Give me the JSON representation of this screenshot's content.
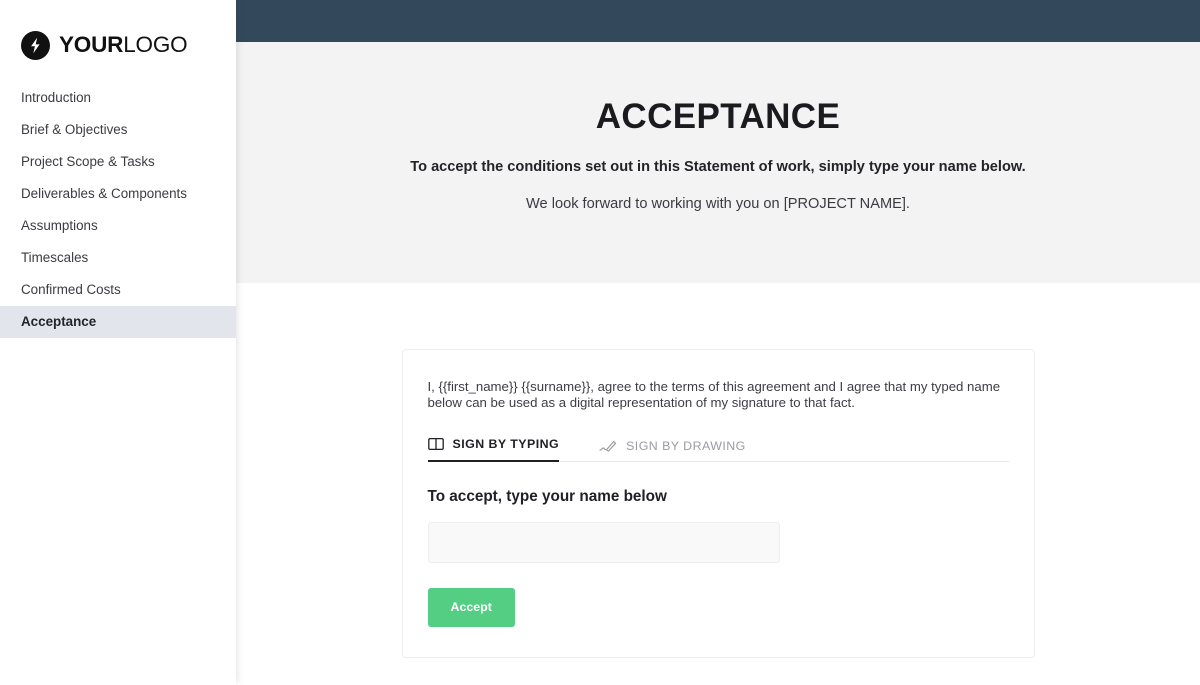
{
  "brand": {
    "logo_bold": "YOUR",
    "logo_light": "LOGO",
    "logo_icon": "lightning-bolt-icon"
  },
  "topbar": {
    "color": "#33485a"
  },
  "sidebar": {
    "items": [
      {
        "label": "Introduction",
        "active": false
      },
      {
        "label": "Brief & Objectives",
        "active": false
      },
      {
        "label": "Project Scope & Tasks",
        "active": false
      },
      {
        "label": "Deliverables & Components",
        "active": false
      },
      {
        "label": "Assumptions",
        "active": false
      },
      {
        "label": "Timescales",
        "active": false
      },
      {
        "label": "Confirmed Costs",
        "active": false
      },
      {
        "label": "Acceptance",
        "active": true
      }
    ],
    "active_background": "#e2e5ec"
  },
  "document": {
    "title": "ACCEPTANCE",
    "subtitle_bold": "To accept the conditions set out in this Statement of work, simply type your name below.",
    "subtitle_regular": "We look forward to working with you on [PROJECT NAME].",
    "header_background": "#f3f3f4"
  },
  "card": {
    "consent_text": "I, {{first_name}} {{surname}}, agree to the terms of this agreement and I agree that my typed name below can be used as a digital representation of my signature to that fact.",
    "tabs": [
      {
        "label": "SIGN BY TYPING",
        "icon": "keyboard-icon",
        "active": true
      },
      {
        "label": "SIGN BY DRAWING",
        "icon": "pen-signature-icon",
        "active": false
      }
    ],
    "field_label": "To accept, type your name below",
    "input_value": "",
    "input_placeholder": "",
    "accept_label": "Accept",
    "accept_color": "#53ce83"
  }
}
